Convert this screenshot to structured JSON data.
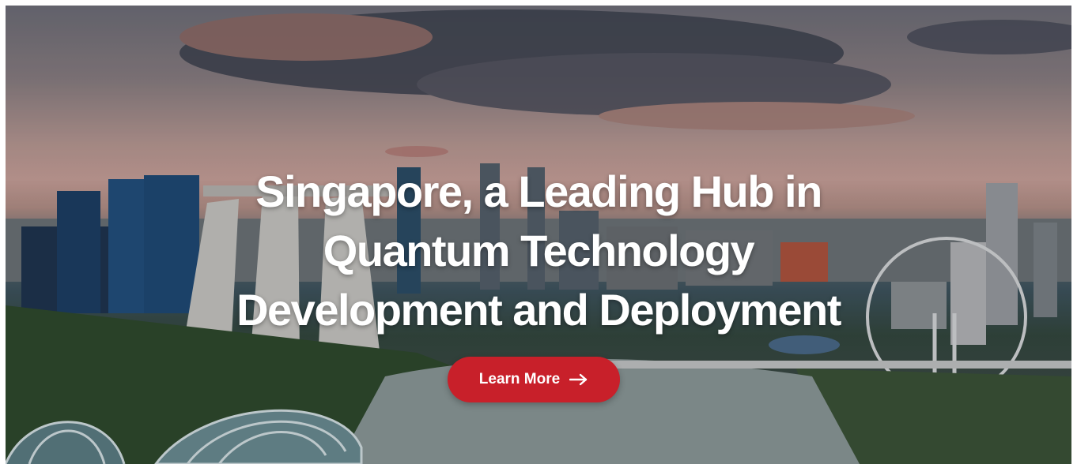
{
  "hero": {
    "headline_lines": [
      "Singapore, a Leading Hub in",
      "Quantum Technology",
      "Development and Deployment"
    ],
    "cta_label": "Learn More",
    "cta_icon": "arrow-right-icon",
    "cta_color": "#c8202a",
    "background_image": "singapore-skyline-photo"
  }
}
